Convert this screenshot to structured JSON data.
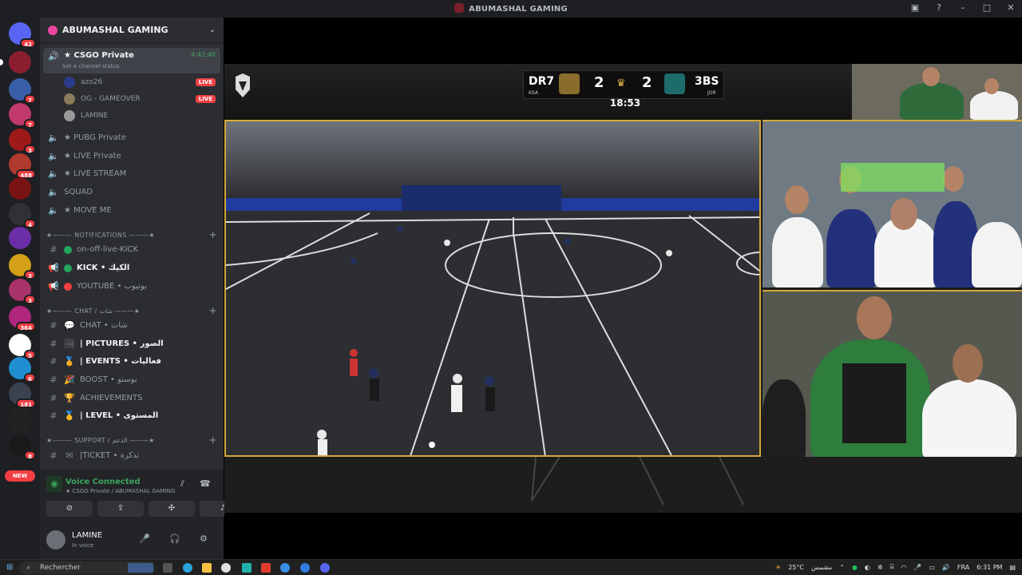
{
  "window": {
    "title": "ABUMASHAL GAMING"
  },
  "rail": {
    "badges": [
      "42",
      "7",
      "7",
      "3",
      "488",
      "4",
      "3",
      "3",
      "364",
      "5",
      "6",
      "181",
      "8"
    ],
    "new_label": "NEW"
  },
  "server": {
    "name": "ABUMASHAL GAMING"
  },
  "channels": {
    "active": {
      "name": "★ CSGO Private",
      "time": "4:42:48",
      "status": "Set a channel status"
    },
    "users": [
      {
        "name": "azo26",
        "live": "LIVE"
      },
      {
        "name": "OG - GAMEOVER",
        "live": "LIVE"
      },
      {
        "name": "LAMINE",
        "live": ""
      }
    ],
    "voice": [
      {
        "name": "★ PUBG Private"
      },
      {
        "name": "★ LIVE Private"
      },
      {
        "name": "★ LIVE STREAM"
      },
      {
        "name": "SQUAD"
      },
      {
        "name": "★ MOVE ME"
      }
    ],
    "cat_notifications": "★——— NOTIFICATIONS ———★",
    "notifications": [
      {
        "name": "on-off-live-KICK",
        "color": "#23a55a"
      },
      {
        "name": "KICK • الكيك",
        "color": "#23a55a"
      },
      {
        "name": "YOUTUBE • يوتيوب",
        "color": "#f23f43"
      }
    ],
    "cat_chat": "★——— CHAT / شات ———★",
    "chat": [
      {
        "name": "CHAT • شات"
      },
      {
        "name": "| PICTURES • الصور"
      },
      {
        "name": "| EVENTS • فعاليات"
      },
      {
        "name": "BOOST • بوستو"
      },
      {
        "name": "ACHIEVEMENTS"
      },
      {
        "name": "| LEVEL • المستوى"
      }
    ],
    "cat_support": "★——— SUPPORT / الدعم ———★",
    "support": [
      {
        "name": "|TICKET • تذكرة"
      }
    ]
  },
  "voice_status": {
    "title": "Voice Connected",
    "sub": "★ CSGO Private / ABUMASHAL GAMING"
  },
  "user_panel": {
    "name": "LAMINE",
    "status": "In voice"
  },
  "scoreboard": {
    "home": "DR7",
    "home_score": "2",
    "away": "3BS",
    "away_score": "2",
    "clock": "18:53",
    "home_country": "KSA",
    "away_country": "JOR"
  },
  "taskbar": {
    "search_placeholder": "Rechercher",
    "weather": "25°C",
    "weather_desc": "مشمس",
    "lang": "FRA",
    "time": "6:31 PM"
  }
}
